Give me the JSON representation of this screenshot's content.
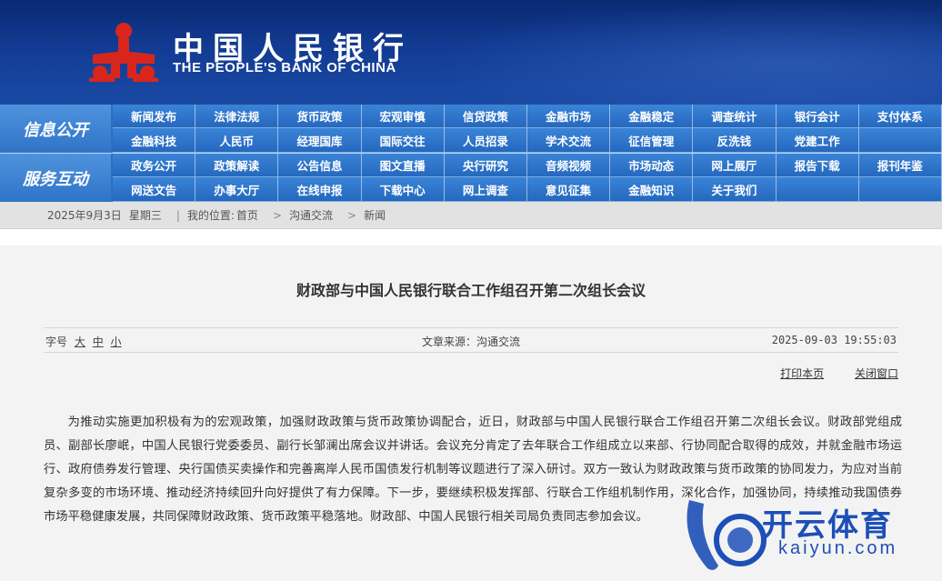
{
  "header": {
    "bank_name_cn": "中国人民银行",
    "bank_name_en": "THE PEOPLE'S BANK OF CHINA"
  },
  "nav": {
    "group1_label": "信息公开",
    "group1_items": [
      "新闻发布",
      "法律法规",
      "货币政策",
      "宏观审慎",
      "信贷政策",
      "金融市场",
      "金融稳定",
      "调查统计",
      "银行会计",
      "支付体系",
      "金融科技",
      "人民币",
      "经理国库",
      "国际交往",
      "人员招录",
      "学术交流",
      "征信管理",
      "反洗钱",
      "党建工作",
      ""
    ],
    "group2_label": "服务互动",
    "group2_items": [
      "政务公开",
      "政策解读",
      "公告信息",
      "图文直播",
      "央行研究",
      "音频视频",
      "市场动态",
      "网上展厅",
      "报告下载",
      "报刊年鉴",
      "网送文告",
      "办事大厅",
      "在线申报",
      "下载中心",
      "网上调查",
      "意见征集",
      "金融知识",
      "关于我们",
      "",
      ""
    ]
  },
  "breadcrumb": {
    "date": "2025年9月3日",
    "weekday": "星期三",
    "location_label": "我的位置:",
    "items": [
      "首页",
      "沟通交流",
      "新闻"
    ]
  },
  "article": {
    "title": "财政部与中国人民银行联合工作组召开第二次组长会议",
    "font_size_label": "字号",
    "font_sizes": [
      "大",
      "中",
      "小"
    ],
    "source": "文章来源：沟通交流",
    "datetime": "2025-09-03 19:55:03",
    "print_label": "打印本页",
    "close_label": "关闭窗口",
    "body": "为推动实施更加积极有为的宏观政策，加强财政政策与货币政策协调配合，近日，财政部与中国人民银行联合工作组召开第二次组长会议。财政部党组成员、副部长廖岷，中国人民银行党委委员、副行长邹澜出席会议并讲话。会议充分肯定了去年联合工作组成立以来部、行协同配合取得的成效，并就金融市场运行、政府债券发行管理、央行国债买卖操作和完善离岸人民币国债发行机制等议题进行了深入研讨。双方一致认为财政政策与货币政策的协同发力，为应对当前复杂多变的市场环境、推动经济持续回升向好提供了有力保障。下一步，要继续积极发挥部、行联合工作组机制作用，深化合作，加强协同，持续推动我国债券市场平稳健康发展，共同保障财政政策、货币政策平稳落地。财政部、中国人民银行相关司局负责同志参加会议。"
  },
  "watermark": {
    "text": "开云体育",
    "domain": "kaiyun.com"
  },
  "colors": {
    "header_bg": "#123b93",
    "nav_bg": "#2a6fc7",
    "logo_red": "#d9261c"
  }
}
